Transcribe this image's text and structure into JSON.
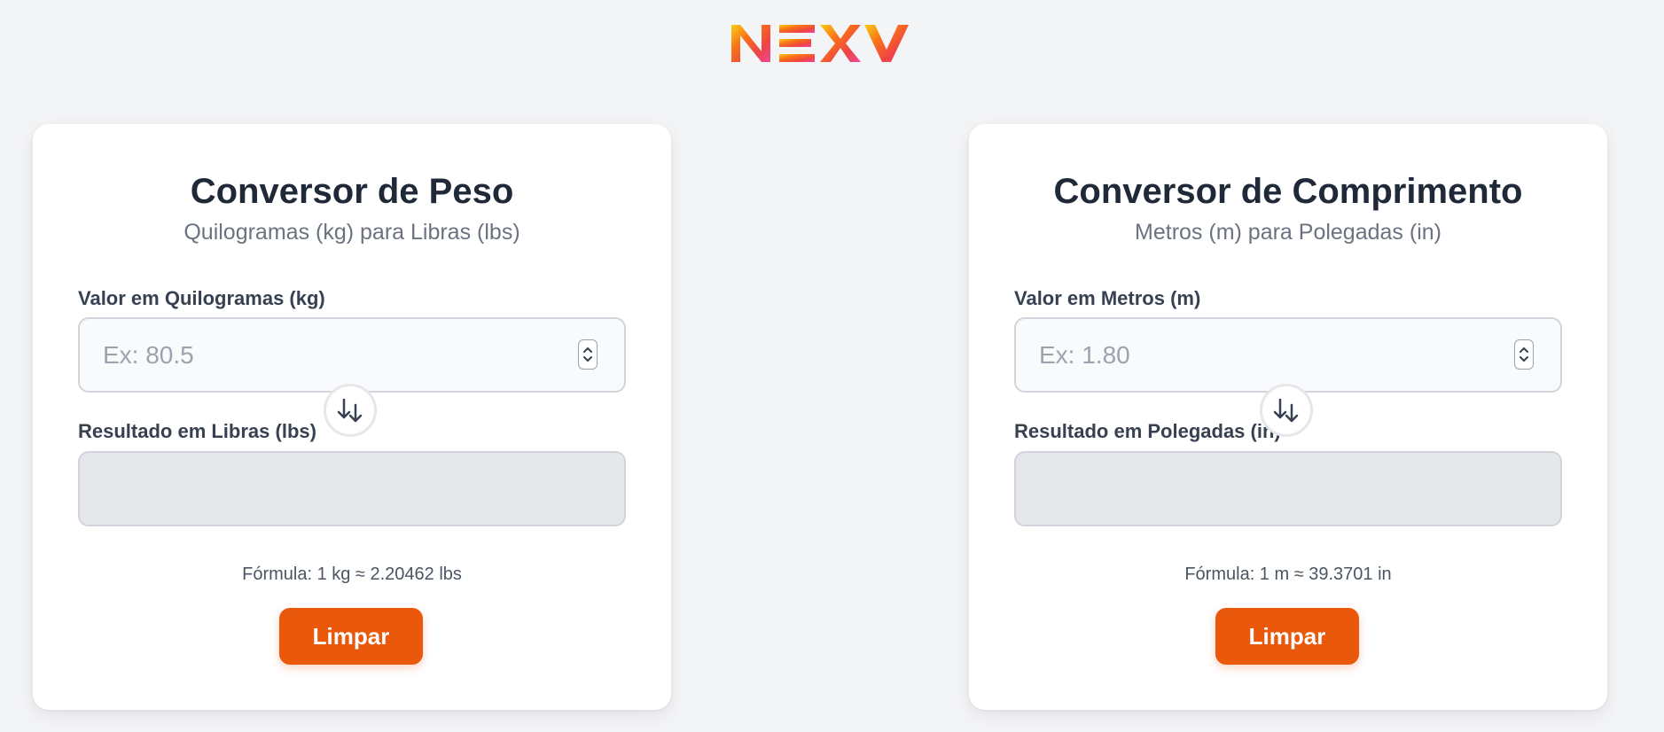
{
  "brand": {
    "logo_text": "NEXV"
  },
  "weight": {
    "title": "Conversor de Peso",
    "subtitle": "Quilogramas (kg) para Libras (lbs)",
    "input_label": "Valor em Quilogramas (kg)",
    "input_placeholder": "Ex: 80.5",
    "result_label": "Resultado em Libras (lbs)",
    "result_value": "",
    "formula": "Fórmula: 1 kg ≈ 2.20462 lbs",
    "clear_label": "Limpar"
  },
  "length": {
    "title": "Conversor de Comprimento",
    "subtitle": "Metros (m) para Polegadas (in)",
    "input_label": "Valor em Metros (m)",
    "input_placeholder": "Ex: 1.80",
    "result_label": "Resultado em Polegadas (in)",
    "result_value": "",
    "formula": "Fórmula: 1 m ≈ 39.3701 in",
    "clear_label": "Limpar"
  },
  "colors": {
    "accent": "#ea580c",
    "background": "#f3f4f6",
    "card": "#ffffff",
    "title": "#1f2937",
    "logo_gradient": [
      "#f97316",
      "#facc15",
      "#ef4444",
      "#ec4899"
    ]
  },
  "icons": {
    "swap": "swap-arrows-icon",
    "spinner": "number-spinner-icon"
  }
}
